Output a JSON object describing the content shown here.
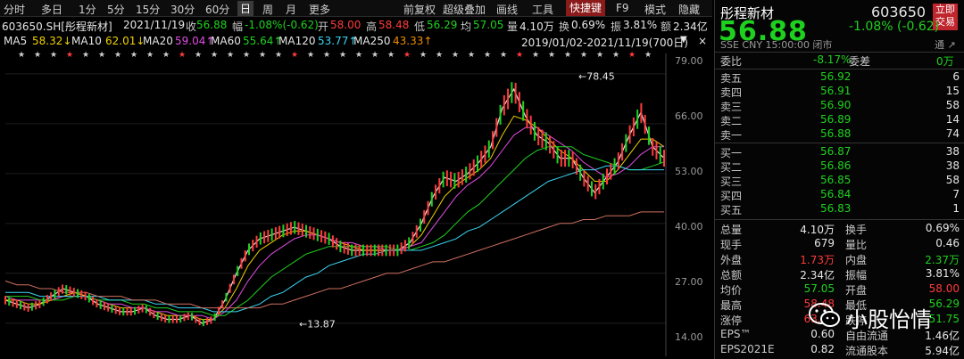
{
  "toolbar": {
    "periods": [
      "分时",
      "多日",
      "1分",
      "5分",
      "15分",
      "30分",
      "60分",
      "日",
      "周",
      "月",
      "更多"
    ],
    "selected": "日",
    "tools": [
      "前复权",
      "超级叠加",
      "画线",
      "工具"
    ],
    "quick_key": "快捷键",
    "tools2": [
      "F9",
      "模式",
      "隐藏"
    ]
  },
  "info": {
    "stock": "603650.SH[彤程新材]",
    "date": "2021/11/19",
    "close_label": "收",
    "close": "56.88",
    "chg_label": "幅",
    "chg": "-1.08%(-0.62)",
    "open_label": "开",
    "open": "58.00",
    "high_label": "高",
    "high": "58.48",
    "low_label": "低",
    "low": "56.29",
    "avg_label": "均",
    "avg": "57.05",
    "vol_label": "量",
    "vol": "4.10万",
    "turn_label": "换",
    "turn": "0.69%",
    "amp_label": "振",
    "amp": "3.81%",
    "amt_label": "额",
    "amt": "2.34亿"
  },
  "ma": {
    "ma5": "MA5",
    "ma5_v": "58.32↓",
    "ma10": "MA10",
    "ma10_v": "62.01↓",
    "ma20": "MA20",
    "ma20_v": "59.04↑",
    "ma60": "MA60",
    "ma60_v": "55.64↑",
    "ma120": "MA120",
    "ma120_v": "53.77↑",
    "ma250": "MA250",
    "ma250_v": "43.33↑",
    "range": "2019/01/02-2021/11/19(700日)"
  },
  "axis": {
    "ticks": [
      "79.00",
      "66.00",
      "53.00",
      "40.00",
      "27.00",
      "14.00"
    ]
  },
  "annotations": {
    "high": "←78.45",
    "low": "←13.87"
  },
  "panel": {
    "name": "彤程新材",
    "code": "603650",
    "tag": "立即交易",
    "price": "56.88",
    "change": "-1.08% (-0.62)",
    "sub": "SSE  CNY  15:00:00  闭市",
    "sub_right": "通 ↗",
    "weibi_label": "委比",
    "weibi": "-8.17%",
    "weicha_label": "委差",
    "weicha": "0万",
    "asks": [
      {
        "label": "卖五",
        "price": "56.92",
        "vol": "6"
      },
      {
        "label": "卖四",
        "price": "56.91",
        "vol": "15"
      },
      {
        "label": "卖三",
        "price": "56.90",
        "vol": "58"
      },
      {
        "label": "卖二",
        "price": "56.89",
        "vol": "14"
      },
      {
        "label": "卖一",
        "price": "56.88",
        "vol": "74"
      }
    ],
    "bids": [
      {
        "label": "买一",
        "price": "56.87",
        "vol": "38"
      },
      {
        "label": "买二",
        "price": "56.86",
        "vol": "38"
      },
      {
        "label": "买三",
        "price": "56.85",
        "vol": "58"
      },
      {
        "label": "买四",
        "price": "56.84",
        "vol": "7"
      },
      {
        "label": "买五",
        "price": "56.83",
        "vol": "1"
      }
    ],
    "stats": [
      {
        "l1": "总量",
        "v1": "4.10万",
        "l2": "换手",
        "v2": "0.69%"
      },
      {
        "l1": "现手",
        "v1": "679",
        "l2": "量比",
        "v2": "0.46"
      },
      {
        "l1": "外盘",
        "v1": "1.73万",
        "l2": "内盘",
        "v2": "2.37万"
      },
      {
        "l1": "总额",
        "v1": "2.34亿",
        "l2": "振幅",
        "v2": "3.81%"
      },
      {
        "l1": "均价",
        "v1": "57.05",
        "l2": "开盘",
        "v2": "58.00"
      },
      {
        "l1": "最高",
        "v1": "58.48",
        "l2": "最低",
        "v2": "56.29"
      },
      {
        "l1": "涨停",
        "v1": "63.36",
        "l2": "跌停",
        "v2": "51.75"
      },
      {
        "l1": "EPS™",
        "v1": "0.60",
        "l2": "自由流通",
        "v2": "1.46亿"
      },
      {
        "l1": "EPS2021E",
        "v1": "0.82",
        "l2": "流通股本",
        "v2": "5.94亿"
      }
    ]
  },
  "watermark": "小股怡情",
  "colors": {
    "up": "#ff3b3b",
    "down": "#1fd11f",
    "bg": "#000000"
  },
  "chart_data": {
    "type": "line",
    "x_range": [
      "2019/01/02",
      "2021/11/19"
    ],
    "ylim": [
      10,
      82
    ],
    "series": [
      {
        "values": [
          20,
          19,
          18,
          19,
          21,
          23,
          22,
          21,
          19,
          18,
          17,
          17,
          18,
          16,
          15,
          15,
          16,
          14,
          15,
          20,
          27,
          33,
          36,
          37,
          38,
          39,
          38,
          37,
          36,
          34,
          33,
          33,
          33,
          33,
          33,
          35,
          40,
          47,
          52,
          51,
          53,
          56,
          60,
          70,
          75,
          68,
          63,
          61,
          57,
          57,
          52,
          48,
          52,
          56,
          63,
          69,
          60,
          57
        ]
      },
      {
        "values": [
          20,
          20,
          19,
          19,
          20,
          21,
          22,
          21,
          20,
          19,
          18,
          18,
          18,
          17,
          16,
          16,
          16,
          15,
          15,
          18,
          23,
          29,
          33,
          35,
          37,
          38,
          38,
          37,
          36,
          35,
          34,
          33,
          33,
          33,
          33,
          34,
          37,
          42,
          47,
          50,
          52,
          54,
          57,
          63,
          68,
          67,
          65,
          62,
          59,
          57,
          54,
          51,
          51,
          54,
          58,
          62,
          62,
          60
        ]
      },
      {
        "values": [
          21,
          20,
          20,
          20,
          20,
          21,
          21,
          21,
          20,
          19,
          19,
          18,
          18,
          17,
          17,
          16,
          16,
          16,
          15,
          17,
          20,
          25,
          29,
          32,
          34,
          36,
          37,
          37,
          36,
          35,
          35,
          34,
          34,
          33,
          33,
          34,
          35,
          39,
          43,
          47,
          50,
          52,
          55,
          59,
          63,
          65,
          65,
          63,
          61,
          59,
          56,
          54,
          52,
          53,
          55,
          58,
          60,
          60
        ]
      },
      {
        "values": [
          21,
          21,
          21,
          20,
          20,
          20,
          21,
          21,
          20,
          20,
          20,
          19,
          19,
          18,
          18,
          17,
          17,
          17,
          16,
          16,
          18,
          20,
          23,
          26,
          28,
          30,
          32,
          33,
          34,
          34,
          34,
          34,
          34,
          34,
          33,
          33,
          34,
          35,
          37,
          40,
          43,
          45,
          48,
          51,
          54,
          57,
          59,
          60,
          60,
          60,
          58,
          57,
          56,
          55,
          54,
          54,
          55,
          56
        ]
      },
      {
        "values": [
          22,
          22,
          22,
          21,
          21,
          21,
          21,
          21,
          21,
          20,
          20,
          20,
          20,
          19,
          19,
          18,
          18,
          18,
          17,
          17,
          17,
          18,
          19,
          21,
          22,
          24,
          26,
          27,
          29,
          30,
          31,
          32,
          32,
          33,
          33,
          33,
          33,
          34,
          35,
          36,
          38,
          39,
          41,
          43,
          45,
          47,
          49,
          51,
          52,
          53,
          54,
          54,
          55,
          55,
          54,
          54,
          54,
          54
        ]
      },
      {
        "values": [
          25,
          24,
          24,
          23,
          23,
          22,
          22,
          22,
          21,
          21,
          21,
          20,
          20,
          20,
          19,
          19,
          19,
          18,
          18,
          18,
          18,
          18,
          18,
          19,
          19,
          20,
          21,
          22,
          23,
          23,
          24,
          25,
          26,
          27,
          27,
          28,
          29,
          30,
          30,
          31,
          32,
          33,
          34,
          35,
          36,
          37,
          38,
          39,
          40,
          40,
          41,
          41,
          42,
          42,
          42,
          43,
          43,
          43
        ]
      }
    ]
  }
}
